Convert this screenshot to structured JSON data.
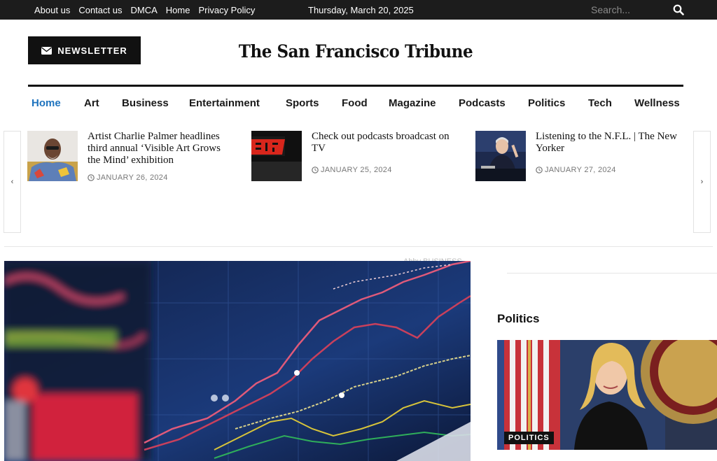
{
  "topbar": {
    "links": [
      "About us",
      "Contact us",
      "DMCA",
      "Home",
      "Privacy Policy"
    ],
    "date": "Thursday, March 20, 2025",
    "search_placeholder": "Search..."
  },
  "header": {
    "newsletter_label": "NEWSLETTER",
    "logo_text": "The San Francisco Tribune"
  },
  "nav": {
    "items": [
      "Home",
      "Art",
      "Business",
      "Entertainment",
      "Sports",
      "Food",
      "Magazine",
      "Podcasts",
      "Politics",
      "Tech",
      "Wellness"
    ],
    "active": "Home"
  },
  "carousel": {
    "prev_icon": "‹",
    "next_icon": "›",
    "slides": [
      {
        "title": "Artist Charlie Palmer headlines third annual ‘Visible Art Grows the Mind’ exhibition",
        "date": "JANUARY 26, 2024"
      },
      {
        "title": "Check out podcasts broadcast on TV",
        "date": "JANUARY 25, 2024"
      },
      {
        "title": "Listening to the N.F.L. | The New Yorker",
        "date": "JANUARY 27, 2024"
      }
    ]
  },
  "hero": {
    "caption": "Abby BUSINESS"
  },
  "sidebar": {
    "heading": "Politics",
    "tag": "POLITICS"
  },
  "colors": {
    "topbar_bg": "#1c1c1c",
    "accent": "#1e73be",
    "text": "#111111"
  }
}
